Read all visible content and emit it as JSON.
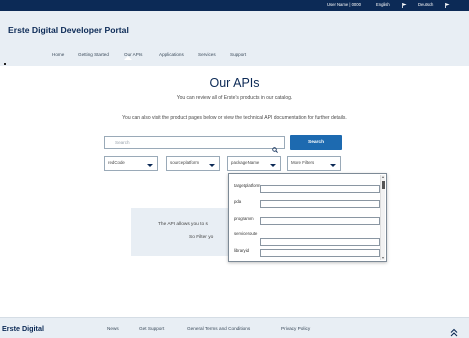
{
  "topbar": {
    "user": "User Name | 0000",
    "lang_en": "English",
    "lang_de": "Deutsch",
    "flag_icon": "flag-icon"
  },
  "header": {
    "title": "Erste Digital Developer Portal",
    "nav": [
      "Home",
      "Getting Started",
      "Our APIs",
      "Applications",
      "Services",
      "Support"
    ],
    "active_nav": "Our APIs"
  },
  "main": {
    "title": "Our APIs",
    "subtitle": "You can review all of Erste's products in our catalog.",
    "subtitle2": "You can also visit the product pages below or view the technical API documentation for further details."
  },
  "search": {
    "placeholder": "Search",
    "icon": "search-icon",
    "button_label": "Search"
  },
  "filters": [
    {
      "label": "redCode"
    },
    {
      "label": "sourceplatform"
    },
    {
      "label": "packageName"
    },
    {
      "label": "More Filters"
    }
  ],
  "more_filters_popup": {
    "fields": [
      {
        "label": "targetplatform",
        "value": ""
      },
      {
        "label": "pda",
        "value": ""
      },
      {
        "label": "programm",
        "value": ""
      },
      {
        "label": "serviceroute",
        "value": ""
      },
      {
        "label": "libraryid",
        "value": ""
      }
    ]
  },
  "info_panel": {
    "line1": "The API allows you to s",
    "line2": "So Filter yo"
  },
  "footer": {
    "brand": "Erste Digital",
    "links": [
      "News",
      "Get Support",
      "General Terms and Conditions",
      "Privacy Policy"
    ],
    "back_to_top_icon": "double-chevron-up-icon"
  },
  "colors": {
    "navy": "#0c2a56",
    "primary_button": "#1d6ab0",
    "header_bg": "#e8eef4"
  }
}
